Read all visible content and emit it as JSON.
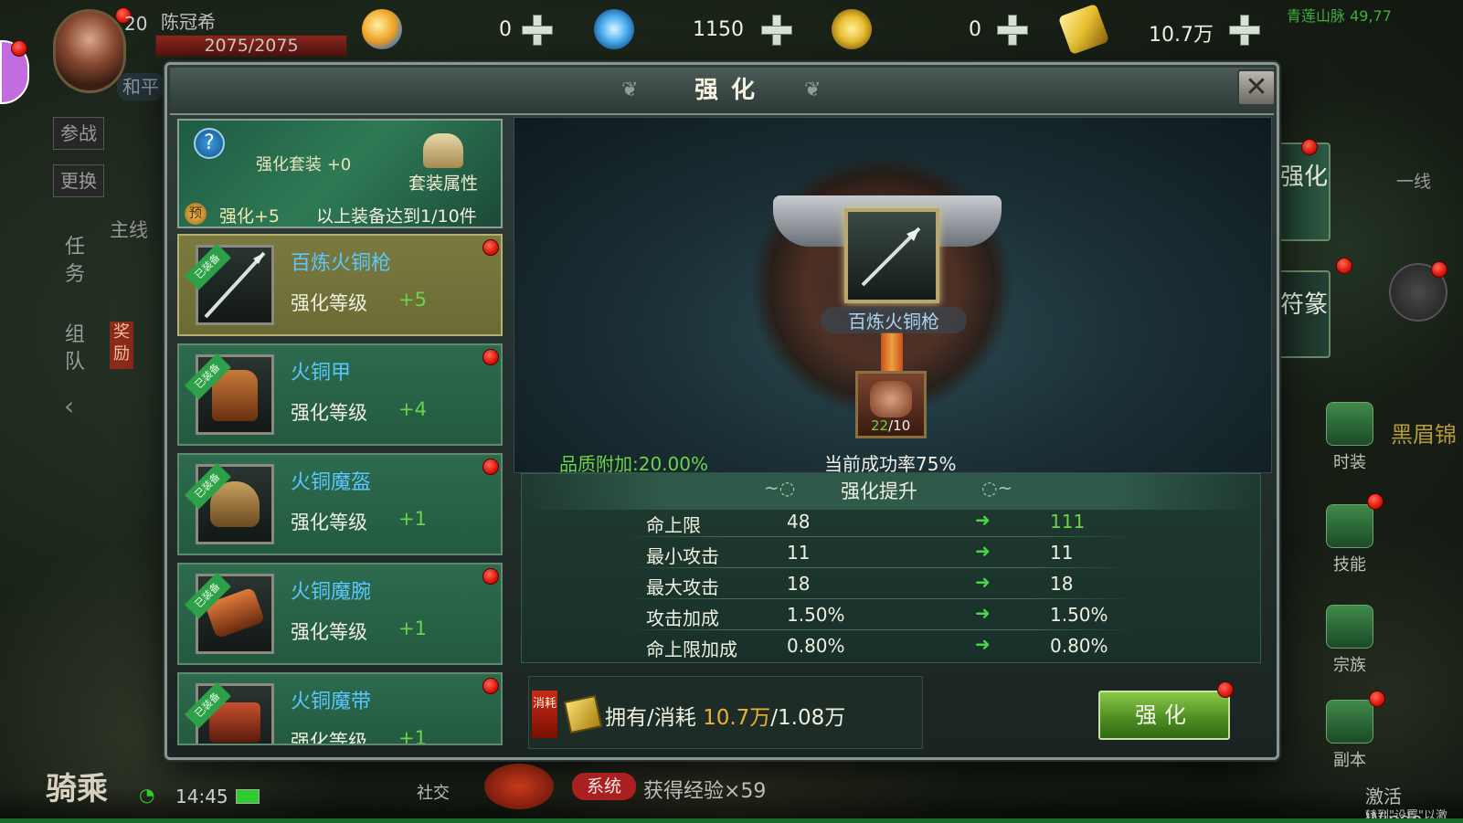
{
  "hud": {
    "player_name": "陈冠希",
    "level": "20",
    "hp": "2075/2075",
    "mode": "和平",
    "zone": "青莲山脉 49,77",
    "line": "一线",
    "resources": [
      {
        "name": "swirl-currency",
        "value": "0",
        "color": "#f0b030"
      },
      {
        "name": "bound-jade",
        "value": "1150",
        "color": "#4ab0f0"
      },
      {
        "name": "copper-coin",
        "value": "0",
        "color": "#e8c030"
      },
      {
        "name": "gold-ingot",
        "value": "10.7万",
        "color": "#e8c030"
      }
    ]
  },
  "left_menu": {
    "join_battle": "参战",
    "swap": "更换",
    "main_quest": "主线",
    "quest": "任务",
    "team": "组队",
    "reward": "奖励"
  },
  "modal": {
    "title": "强化",
    "close_label": "✕",
    "suit": {
      "title": "强化套装 +0",
      "attr_button": "套装属性",
      "preview_badge": "预",
      "preview_level": "强化+5",
      "preview_requirement": "以上装备达到1/10件"
    },
    "items": [
      {
        "name": "百炼火铜枪",
        "level_label": "强化等级",
        "level": "+5",
        "tag": "已装备",
        "selected": true
      },
      {
        "name": "火铜甲",
        "level_label": "强化等级",
        "level": "+4",
        "tag": "已装备",
        "selected": false
      },
      {
        "name": "火铜魔盔",
        "level_label": "强化等级",
        "level": "+1",
        "tag": "已装备",
        "selected": false
      },
      {
        "name": "火铜魔腕",
        "level_label": "强化等级",
        "level": "+1",
        "tag": "已装备",
        "selected": false
      },
      {
        "name": "火铜魔带",
        "level_label": "强化等级",
        "level": "+1",
        "tag": "已装备",
        "selected": false
      }
    ],
    "preview": {
      "selected_item": "百炼火铜枪",
      "material_owned": "22",
      "material_required": "/10",
      "quality_bonus": "品质附加:20.00%",
      "success_rate": "当前成功率75%"
    },
    "upgrade": {
      "title": "强化提升",
      "stats": [
        {
          "name": "命上限",
          "current": "48",
          "next": "111",
          "up": true
        },
        {
          "name": "最小攻击",
          "current": "11",
          "next": "11",
          "up": false
        },
        {
          "name": "最大攻击",
          "current": "18",
          "next": "18",
          "up": false
        },
        {
          "name": "攻击加成",
          "current": "1.50%",
          "next": "1.50%",
          "up": false
        },
        {
          "name": "命上限加成",
          "current": "0.80%",
          "next": "0.80%",
          "up": false
        }
      ]
    },
    "cost": {
      "tag": "消耗",
      "label": "拥有/消耗",
      "owned": "10.7万",
      "required": "/1.08万"
    },
    "enhance_button": "强化"
  },
  "side_tabs": [
    {
      "label": "强化",
      "active": true
    },
    {
      "label": "符篆",
      "active": false
    }
  ],
  "side_icons": [
    {
      "label": "时装"
    },
    {
      "label": "技能"
    },
    {
      "label": "宗族"
    },
    {
      "label": "副本"
    }
  ],
  "side_extra": "黑眉锦",
  "bottom": {
    "mount": "骑乘",
    "time": "14:45",
    "social": "社交",
    "system_tag": "系统",
    "system_msg": "获得经验×59",
    "activate_line1": "激活 Windo",
    "activate_line2": "转到\"设置\"以激"
  }
}
